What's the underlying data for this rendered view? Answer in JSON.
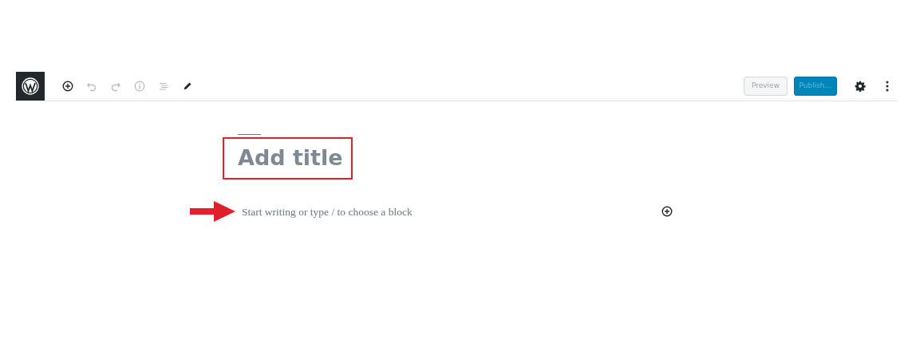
{
  "toolbar": {
    "tools": [
      {
        "kind": "add",
        "disabled": false
      },
      {
        "kind": "undo",
        "disabled": true
      },
      {
        "kind": "redo",
        "disabled": true
      },
      {
        "kind": "info",
        "disabled": true
      },
      {
        "kind": "outline",
        "disabled": true
      },
      {
        "kind": "edit",
        "disabled": false
      }
    ],
    "preview_button": "Preview",
    "publish_button": "Publish…"
  },
  "editor": {
    "title": {
      "placeholder": "Add title"
    },
    "paragraph": {
      "placeholder": "Start writing or type / to choose a block"
    }
  }
}
